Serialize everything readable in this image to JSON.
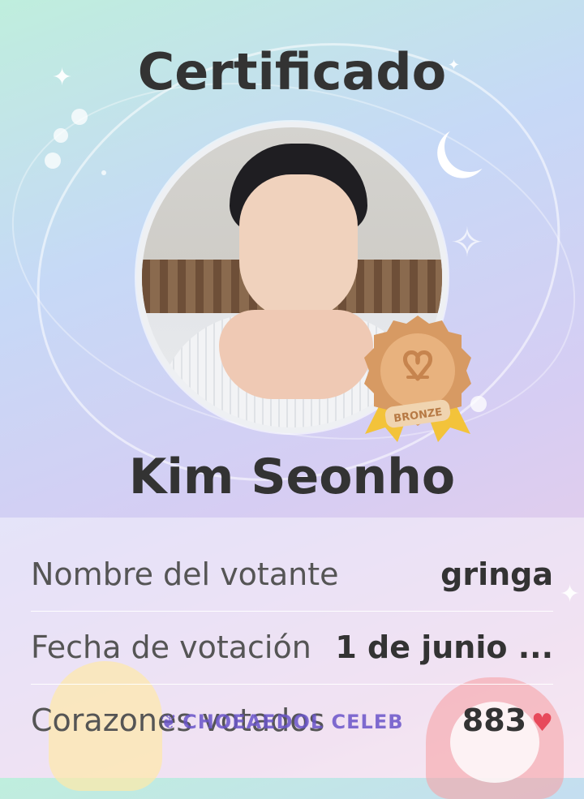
{
  "certificate": {
    "title": "Certificado",
    "celebrity_name": "Kim Seonho",
    "medal_label": "BRONZE",
    "rows": [
      {
        "label": "Nombre del votante",
        "value": "gringa"
      },
      {
        "label": "Fecha de votación",
        "value": "1 de junio ..."
      },
      {
        "label": "Corazones votados",
        "value": "883"
      }
    ],
    "brand": "CHOEAEDOL CELEB"
  },
  "icons": {
    "heart": "heart-icon",
    "medal": "bronze-medal-icon",
    "moon": "moon-icon",
    "sparkle": "sparkle-icon"
  },
  "colors": {
    "medal": "#d79a63",
    "ribbon": "#f3c33a",
    "heart": "#e74a5b",
    "text": "#333333"
  }
}
